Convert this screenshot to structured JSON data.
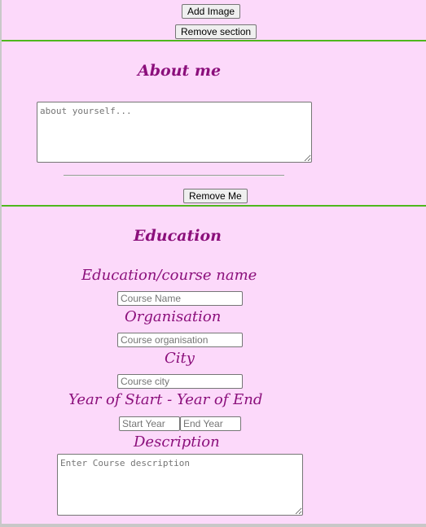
{
  "image_section": {
    "add_image_label": "Add Image",
    "remove_section_label": "Remove section"
  },
  "about": {
    "title": "About me",
    "textarea_placeholder": "about yourself...",
    "remove_label": "Remove Me"
  },
  "education": {
    "title": "Education",
    "course_name_label": "Education/course name",
    "course_name_placeholder": "Course Name",
    "organisation_label": "Organisation",
    "organisation_placeholder": "Course organisation",
    "city_label": "City",
    "city_placeholder": "Course city",
    "years_label": "Year of Start - Year of End",
    "start_year_placeholder": "Start Year",
    "end_year_placeholder": "End Year",
    "description_label": "Description",
    "description_placeholder": "Enter Course description"
  },
  "colors": {
    "background": "#fcd9fa",
    "divider": "#4fb81d",
    "heading": "#8b0f7b"
  }
}
